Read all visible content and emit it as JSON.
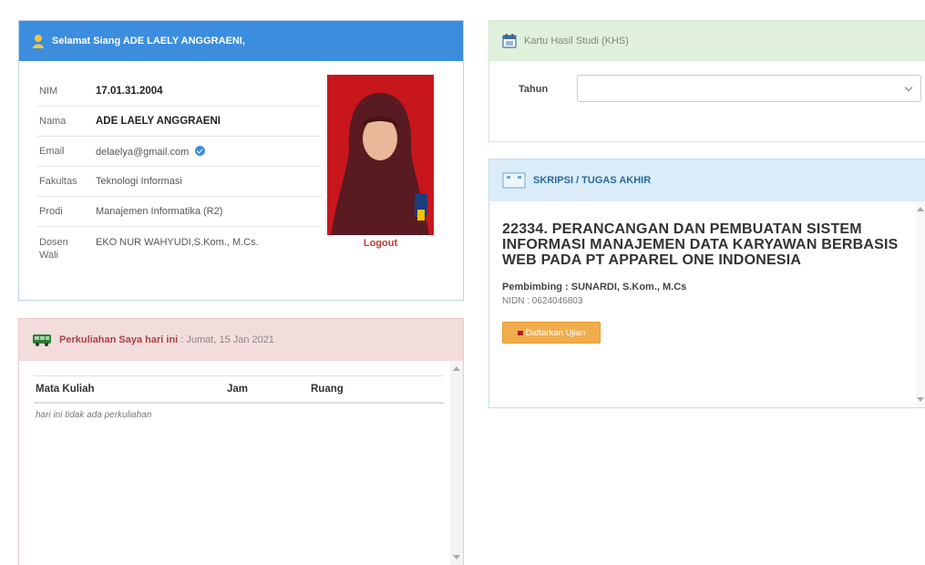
{
  "profile": {
    "greeting": "Selamat Siang ADE LAELY ANGGRAENI,",
    "fields": [
      {
        "label": "NIM",
        "value": "17.01.31.2004"
      },
      {
        "label": "Nama",
        "value": "ADE LAELY ANGGRAENI"
      },
      {
        "label": "Email",
        "value": "delaelya@gmail.com"
      },
      {
        "label": "Fakultas",
        "value": "Teknologi Informasi"
      },
      {
        "label": "Prodi",
        "value": "Manajemen Informatika (R2)"
      },
      {
        "label": "Dosen Wali",
        "value": "EKO NUR WAHYUDI,S.Kom., M.Cs."
      }
    ],
    "logout_label": "Logout"
  },
  "kuliah": {
    "title": "Perkuliahan Saya hari ini",
    "date": "Jumat, 15 Jan 2021",
    "columns": [
      "Mata Kuliah",
      "Jam",
      "Ruang"
    ],
    "empty_message": "hari ini tidak ada perkuliahan"
  },
  "khs": {
    "title": "Kartu Hasil Studi (KHS)",
    "tahun_label": "Tahun",
    "tahun_value": ""
  },
  "skripsi": {
    "title": "SKRIPSI / TUGAS AKHIR",
    "judul": "22334. PERANCANGAN DAN PEMBUATAN SISTEM INFORMASI MANAJEMEN DATA KARYAWAN BERBASIS WEB PADA PT APPAREL ONE INDONESIA",
    "pembimbing": "Pembimbing : SUNARDI, S.Kom., M.Cs",
    "nidn": "NIDN : 0624046803",
    "button_label": "Daftarkan Ujian"
  },
  "icons": {
    "profile": "user-icon",
    "kuliah": "bus-icon",
    "khs": "calendar-icon",
    "skripsi": "screen-icon"
  },
  "colors": {
    "primary": "#3c8dde",
    "danger_bg": "#f3dcdc",
    "success_bg": "#e0f0db",
    "info_bg": "#d9ecf7",
    "warning": "#f0ad4e"
  }
}
